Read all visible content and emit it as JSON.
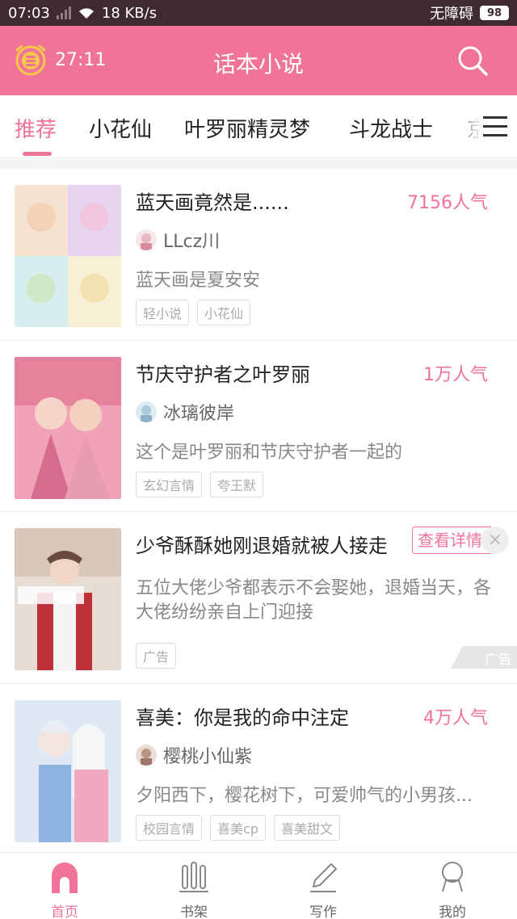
{
  "status_bar": {
    "time": "07:03",
    "net_speed": "18 KB/s",
    "accessibility": "无障碍",
    "battery": "98"
  },
  "header": {
    "timer": "27:11",
    "title": "话本小说",
    "icons": {
      "timer": "alarm-clock-coin-icon",
      "search": "search-icon"
    }
  },
  "tabs": [
    {
      "label": "推荐"
    },
    {
      "label": "小花仙"
    },
    {
      "label": "叶罗丽精灵梦"
    },
    {
      "label": "斗龙战士"
    },
    {
      "label": "京"
    }
  ],
  "feed": [
    {
      "title": "蓝天画竟然是......",
      "popularity": "7156人气",
      "author": "LLcz川",
      "description": "蓝天画是夏安安",
      "tags": [
        "轻小说",
        "小花仙"
      ]
    },
    {
      "title": "节庆守护者之叶罗丽",
      "popularity": "1万人气",
      "author": "冰璃彼岸",
      "description": "这个是叶罗丽和节庆守护者一起的",
      "tags": [
        "玄幻言情",
        "夸王默"
      ]
    }
  ],
  "ad": {
    "title": "少爷酥酥她刚退婚就被人接走",
    "detail_button": "查看详情",
    "close": "×",
    "description": "五位大佬少爷都表示不会娶她，退婚当天，各大佬纷纷亲自上门迎接",
    "tag": "广告",
    "badge": "广告"
  },
  "feed2": [
    {
      "title": "喜美：你是我的命中注定",
      "popularity": "4万人气",
      "author": "樱桃小仙紫",
      "description": "夕阳西下，樱花树下，可爱帅气的小男孩...",
      "tags": [
        "校园言情",
        "喜美cp",
        "喜美甜文"
      ]
    }
  ],
  "bottom_nav": [
    {
      "label": "首页",
      "icon": "home-icon"
    },
    {
      "label": "书架",
      "icon": "bookshelf-icon"
    },
    {
      "label": "写作",
      "icon": "pencil-icon"
    },
    {
      "label": "我的",
      "icon": "profile-icon"
    }
  ],
  "colors": {
    "accent": "#f07497",
    "status_bar": "#402a32"
  }
}
